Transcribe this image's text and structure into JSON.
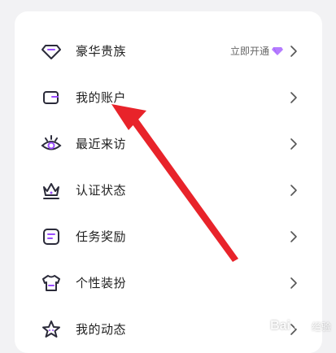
{
  "menu": {
    "items": [
      {
        "label": "豪华贵族",
        "extra": "立即开通",
        "icon": "diamond-icon"
      },
      {
        "label": "我的账户",
        "icon": "wallet-icon"
      },
      {
        "label": "最近来访",
        "icon": "eye-icon"
      },
      {
        "label": "认证状态",
        "icon": "crown-icon"
      },
      {
        "label": "任务奖励",
        "icon": "task-icon"
      },
      {
        "label": "个性装扮",
        "icon": "shirt-icon"
      },
      {
        "label": "我的动态",
        "icon": "star-icon"
      }
    ]
  },
  "colors": {
    "icon_stroke": "#2b2b3a",
    "accent_purple": "#9b4dff",
    "arrow_red": "#e8232a",
    "chevron": "#555555"
  },
  "watermark": {
    "text": "Bai",
    "sub": "经验"
  }
}
